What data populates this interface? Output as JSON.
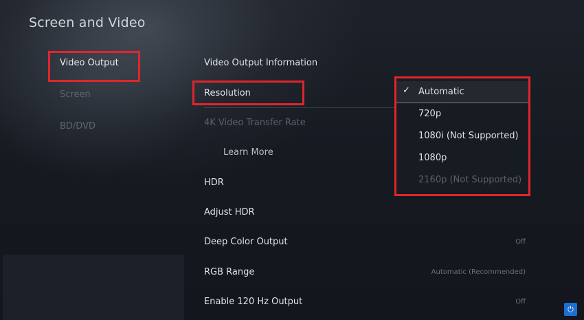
{
  "page": {
    "title": "Screen and Video"
  },
  "sidebar": {
    "items": [
      {
        "label": "Video Output"
      },
      {
        "label": "Screen"
      },
      {
        "label": "BD/DVD"
      }
    ]
  },
  "settings": {
    "rows": [
      {
        "label": "Video Output Information",
        "value": ""
      },
      {
        "label": "Resolution",
        "value": ""
      },
      {
        "label": "4K Video Transfer Rate",
        "value": ""
      },
      {
        "label": "Learn More",
        "value": ""
      },
      {
        "label": "HDR",
        "value": ""
      },
      {
        "label": "Adjust HDR",
        "value": ""
      },
      {
        "label": "Deep Color Output",
        "value": "Off"
      },
      {
        "label": "RGB Range",
        "value": "Automatic (Recommended)"
      },
      {
        "label": "Enable 120 Hz Output",
        "value": "Off"
      }
    ]
  },
  "resolution_dropdown": {
    "options": [
      {
        "label": "Automatic",
        "selected": true,
        "disabled": false
      },
      {
        "label": "720p",
        "selected": false,
        "disabled": false
      },
      {
        "label": "1080i (Not Supported)",
        "selected": false,
        "disabled": false
      },
      {
        "label": "1080p",
        "selected": false,
        "disabled": false
      },
      {
        "label": "2160p (Not Supported)",
        "selected": false,
        "disabled": true
      }
    ]
  },
  "icons": {
    "check": "check-icon",
    "power": "power-icon"
  },
  "colors": {
    "highlight": "#e0262b",
    "power_button": "#1d6fd1"
  }
}
